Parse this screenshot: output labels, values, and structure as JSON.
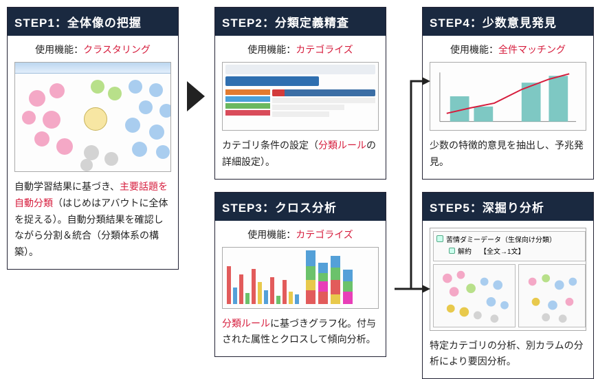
{
  "feature_label": "使用機能：",
  "steps": {
    "s1": {
      "title": "STEP1：全体像の把握",
      "feature": "クラスタリング",
      "desc_pre": "自動学習結果に基づき、",
      "desc_red": "主要話題を自動分類",
      "desc_post": "（はじめはアバウトに全体を捉える）。自動分類結果を確認しながら分割＆統合（分類体系の構築）。"
    },
    "s2": {
      "title": "STEP2：分類定義精査",
      "feature": "カテゴライズ",
      "desc_pre": "カテゴリ条件の設定（",
      "desc_red": "分類ルール",
      "desc_post": "の詳細設定）。"
    },
    "s3": {
      "title": "STEP3：クロス分析",
      "feature": "カテゴライズ",
      "desc_red": "分類ルール",
      "desc_post": "に基づきグラフ化。付与された属性とクロスして傾向分析。"
    },
    "s4": {
      "title": "STEP4：少数意見発見",
      "feature": "全件マッチング",
      "desc": "少数の特徴的意見を抽出し、予兆発見。"
    },
    "s5": {
      "title": "STEP5：深掘り分析",
      "tree_root": "苦情ダミーデータ（生保向け分類）",
      "tree_child_a": "解約",
      "tree_child_b": "【全文→1文】",
      "desc": "特定カテゴリの分析、別カラムの分析により要因分析。"
    }
  },
  "chart_data": {
    "type": "flow-diagram",
    "nodes": [
      {
        "id": "s1",
        "label": "STEP1：全体像の把握"
      },
      {
        "id": "s2",
        "label": "STEP2：分類定義精査"
      },
      {
        "id": "s3",
        "label": "STEP3：クロス分析"
      },
      {
        "id": "s4",
        "label": "STEP4：少数意見発見"
      },
      {
        "id": "s5",
        "label": "STEP5：深掘り分析"
      }
    ],
    "edges": [
      {
        "from": "s1",
        "to": "s2"
      },
      {
        "from": "s2",
        "to": "s3",
        "implicit_vertical": true
      },
      {
        "from": "s3",
        "to": "s4"
      },
      {
        "from": "s3",
        "to": "s5"
      }
    ]
  }
}
